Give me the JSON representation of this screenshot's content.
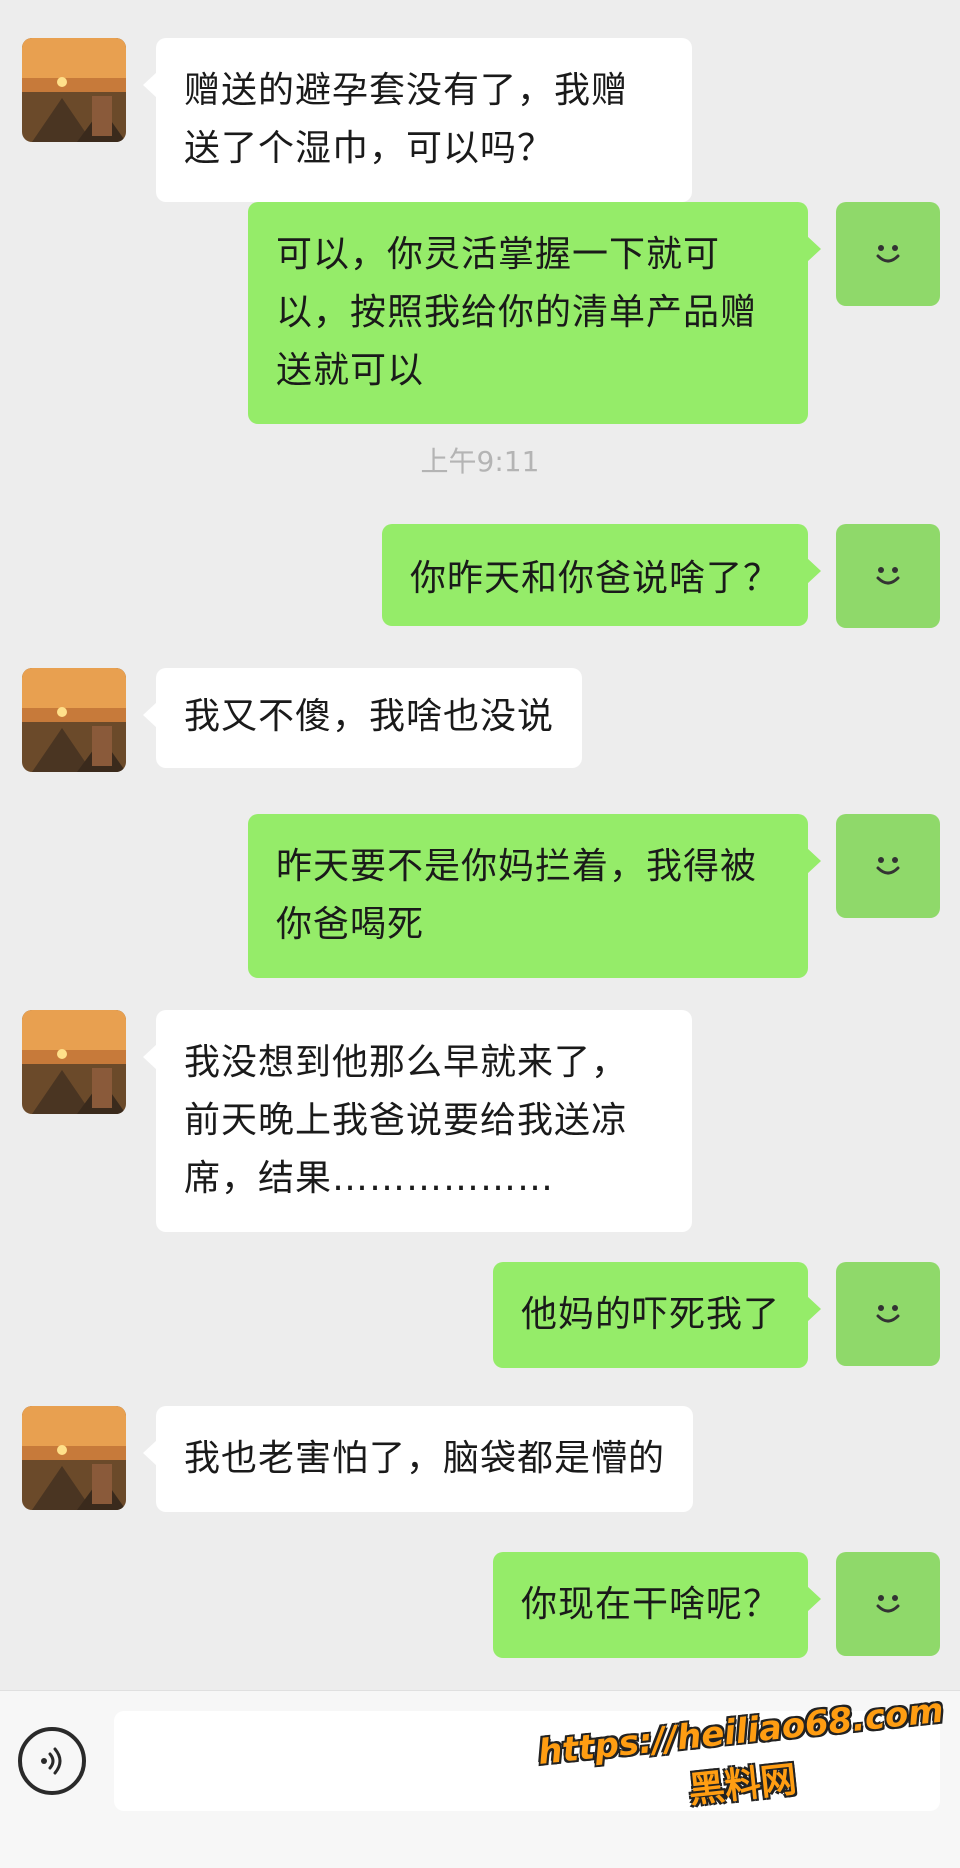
{
  "conversation": {
    "messages": [
      {
        "side": "in",
        "text": "赠送的避孕套没有了，我赠送了个湿巾，可以吗？"
      },
      {
        "side": "out",
        "text": "可以，你灵活掌握一下就可以，按照我给你的清单产品赠送就可以"
      },
      {
        "side": "out",
        "text": "你昨天和你爸说啥了？"
      },
      {
        "side": "in",
        "text": "我又不傻，我啥也没说"
      },
      {
        "side": "out",
        "text": "昨天要不是你妈拦着，我得被你爸喝死"
      },
      {
        "side": "in",
        "text": "我没想到他那么早就来了，前天晚上我爸说要给我送凉席，结果………………"
      },
      {
        "side": "out",
        "text": "他妈的吓死我了"
      },
      {
        "side": "in",
        "text": "我也老害怕了，脑袋都是懵的"
      },
      {
        "side": "out",
        "text": "你现在干啥呢？"
      }
    ],
    "timestamp": "上午9:11"
  },
  "input_bar": {
    "voice_icon": "voice-icon",
    "text_value": ""
  },
  "watermark": {
    "url": "https://heiliao68.com",
    "name": "黑料网"
  },
  "colors": {
    "background": "#ededed",
    "incoming_bubble": "#ffffff",
    "outgoing_bubble": "#95ec69",
    "self_avatar": "#8fd96a",
    "watermark": "#ff9d12"
  }
}
